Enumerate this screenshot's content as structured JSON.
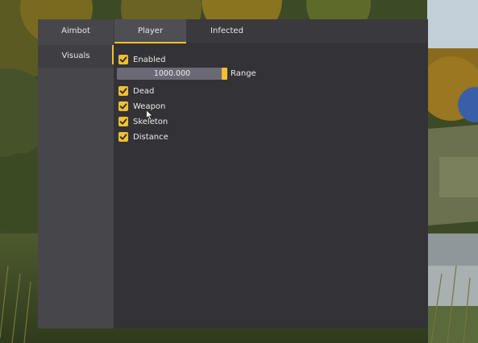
{
  "top_tabs": {
    "aimbot": "Aimbot",
    "player": "Player",
    "infected": "Infected"
  },
  "sidebar": {
    "visuals": "Visuals"
  },
  "player_settings": {
    "enabled": {
      "label": "Enabled",
      "checked": true
    },
    "range": {
      "value": "1000.000",
      "label": "Range",
      "fill_fraction": 1.0
    },
    "dead": {
      "label": "Dead",
      "checked": true
    },
    "weapon": {
      "label": "Weapon",
      "checked": true
    },
    "skeleton": {
      "label": "Skeleton",
      "checked": true
    },
    "distance": {
      "label": "Distance",
      "checked": true
    }
  },
  "theme": {
    "accent": "#f0c030",
    "panel": "#3a393e",
    "content": "#333237",
    "text": "#ececec"
  },
  "icons": {
    "checkmark": "checkmark-icon",
    "cursor": "mouse-cursor-icon"
  }
}
